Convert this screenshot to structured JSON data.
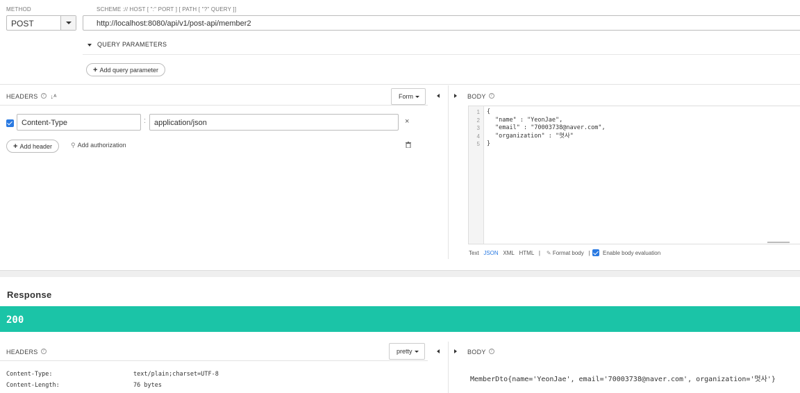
{
  "request": {
    "method_label": "METHOD",
    "method_value": "POST",
    "url_label": "SCHEME :// HOST [ \":\" PORT ] [ PATH [ \"?\" QUERY ]]",
    "url_value": "http://localhost:8080/api/v1/post-api/member2",
    "query_params_label": "QUERY PARAMETERS",
    "add_query_param": "Add query parameter",
    "headers_label": "HEADERS",
    "form_label": "Form",
    "headers": [
      {
        "name": "Content-Type",
        "value": "application/json"
      }
    ],
    "add_header": "Add header",
    "add_authorization": "Add authorization",
    "body_label": "BODY",
    "body_lines": [
      {
        "num": "1",
        "text": "{"
      },
      {
        "num": "2",
        "text": "\"name\" : \"YeonJae\","
      },
      {
        "num": "3",
        "text": "\"email\" : \"70003738@naver.com\","
      },
      {
        "num": "4",
        "text": "\"organization\" : \"멋사\""
      },
      {
        "num": "5",
        "text": "}"
      }
    ],
    "body_formats": {
      "text": "Text",
      "json": "JSON",
      "xml": "XML",
      "html": "HTML",
      "format_body": "Format body",
      "enable_eval": "Enable body evaluation"
    }
  },
  "response": {
    "title": "Response",
    "status": "200",
    "headers_label": "HEADERS",
    "pretty_label": "pretty",
    "headers": [
      {
        "name": "Content-Type:",
        "value": "text/plain;charset=UTF-8"
      },
      {
        "name": "Content-Length:",
        "value": "76 bytes"
      }
    ],
    "body_label": "BODY",
    "body_text": "MemberDto{name='YeonJae', email='70003738@naver.com', organization='멋사'}"
  },
  "colors": {
    "status_bar": "#1bc4a7",
    "accent": "#2a7ae2"
  }
}
